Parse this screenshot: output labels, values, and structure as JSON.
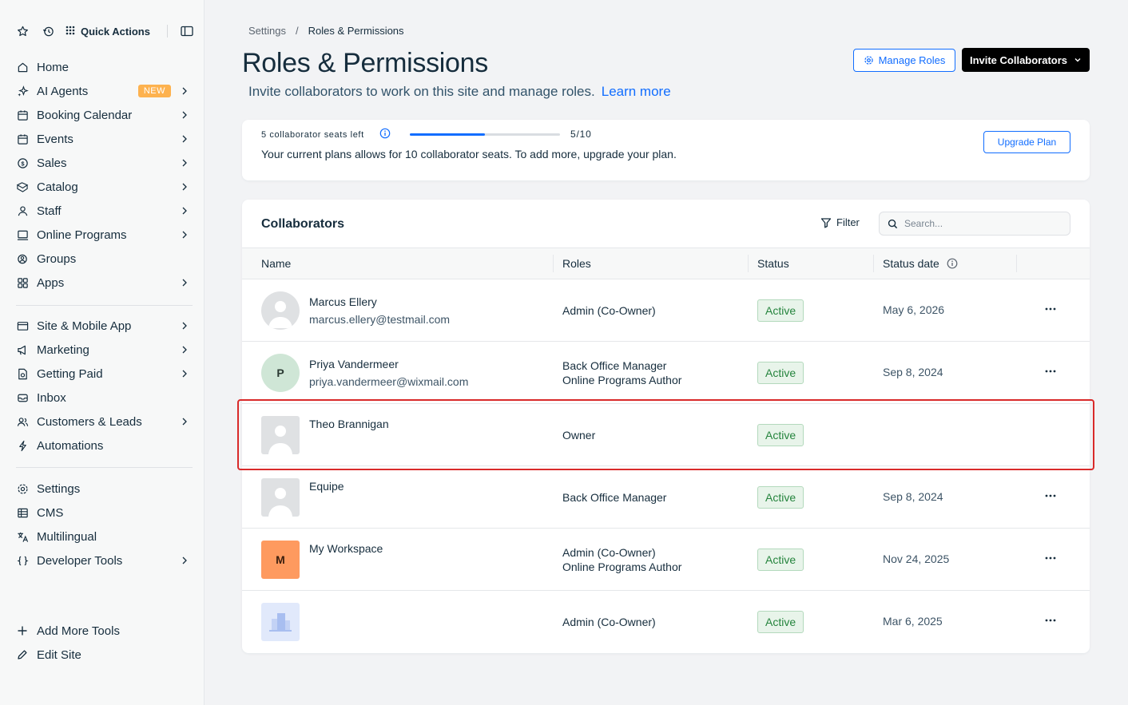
{
  "sidebar": {
    "quick_actions": "Quick Actions",
    "items": [
      {
        "label": "Home",
        "icon": "home-icon"
      },
      {
        "label": "AI Agents",
        "icon": "sparkle-icon",
        "badge": "NEW"
      },
      {
        "label": "Booking Calendar",
        "icon": "calendar-icon"
      },
      {
        "label": "Events",
        "icon": "calendar-icon"
      },
      {
        "label": "Sales",
        "icon": "dollar-icon"
      },
      {
        "label": "Catalog",
        "icon": "tag-icon"
      },
      {
        "label": "Staff",
        "icon": "staff-icon"
      },
      {
        "label": "Online Programs",
        "icon": "programs-icon"
      },
      {
        "label": "Groups",
        "icon": "groups-icon"
      },
      {
        "label": "Apps",
        "icon": "apps-icon"
      },
      {
        "label": "Site & Mobile App",
        "icon": "site-icon"
      },
      {
        "label": "Marketing",
        "icon": "megaphone-icon"
      },
      {
        "label": "Getting Paid",
        "icon": "invoice-icon"
      },
      {
        "label": "Inbox",
        "icon": "inbox-icon"
      },
      {
        "label": "Customers & Leads",
        "icon": "customers-icon"
      },
      {
        "label": "Automations",
        "icon": "bolt-icon"
      },
      {
        "label": "Settings",
        "icon": "gear-icon"
      },
      {
        "label": "CMS",
        "icon": "cms-icon"
      },
      {
        "label": "Multilingual",
        "icon": "translate-icon"
      },
      {
        "label": "Developer Tools",
        "icon": "code-icon"
      },
      {
        "label": "Add More Tools",
        "icon": "plus-icon"
      },
      {
        "label": "Edit Site",
        "icon": "pencil-icon"
      }
    ]
  },
  "breadcrumb": {
    "parent": "Settings",
    "separator": "/",
    "current": "Roles & Permissions"
  },
  "header": {
    "title": "Roles & Permissions",
    "subtitle": "Invite collaborators to work on this site and manage roles.",
    "learn_more": "Learn more",
    "manage_roles": "Manage Roles",
    "invite": "Invite Collaborators"
  },
  "seats": {
    "label": "5 collaborator seats left",
    "count": "5/10",
    "used_fraction": 0.5,
    "description": "Your current plans allows for 10 collaborator seats. To add more, upgrade your plan.",
    "upgrade": "Upgrade Plan"
  },
  "collaborators": {
    "title": "Collaborators",
    "filter": "Filter",
    "search_placeholder": "Search...",
    "columns": {
      "name": "Name",
      "roles": "Roles",
      "status": "Status",
      "status_date": "Status date"
    },
    "rows": [
      {
        "name": "Marcus Ellery",
        "email": "marcus.ellery@testmail.com",
        "roles": [
          "Admin (Co-Owner)"
        ],
        "status": "Active",
        "date": "May 6, 2026",
        "avatar": "person"
      },
      {
        "name": "Priya Vandermeer",
        "email": "priya.vandermeer@wixmail.com",
        "roles": [
          "Back Office Manager",
          "Online Programs Author"
        ],
        "status": "Active",
        "date": "Sep 8, 2024",
        "avatar": "P"
      },
      {
        "name": "Theo Brannigan",
        "email": "",
        "roles": [
          "Owner"
        ],
        "status": "Active",
        "date": "",
        "avatar": "person"
      },
      {
        "name": "Equipe",
        "email": "",
        "roles": [
          "Back Office Manager"
        ],
        "status": "Active",
        "date": "Sep 8, 2024",
        "avatar": "person"
      },
      {
        "name": "My Workspace",
        "email": "",
        "roles": [
          "Admin (Co-Owner)",
          "Online Programs Author"
        ],
        "status": "Active",
        "date": "Nov 24, 2025",
        "avatar": "M"
      },
      {
        "name": "",
        "email": "",
        "roles": [
          "Admin (Co-Owner)"
        ],
        "status": "Active",
        "date": "Mar 6, 2025",
        "avatar": "building"
      }
    ]
  },
  "colors": {
    "accent": "#116dff",
    "active_green": "#25843d",
    "highlight": "#d92a2a",
    "avatar_orange": "#fe9a5f",
    "avatar_green": "#cfe6d6"
  }
}
